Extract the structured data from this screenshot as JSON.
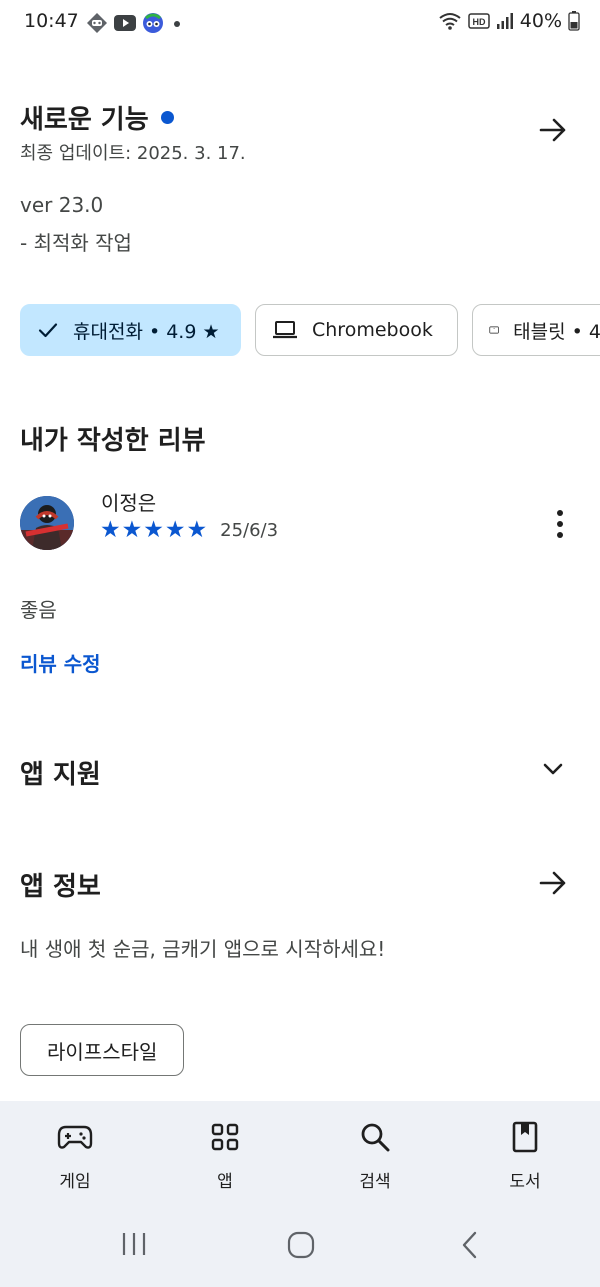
{
  "status_bar": {
    "time": "10:47",
    "battery_text": "40%",
    "icons_left": [
      "ai-badge-icon",
      "youtube-icon",
      "app-mascot-icon",
      "notification-dot-icon"
    ],
    "icons_right": [
      "wifi-icon",
      "hd-icon",
      "signal-icon",
      "battery-icon"
    ]
  },
  "whats_new": {
    "title": "새로운 기능",
    "last_updated": "최종 업데이트: 2025. 3. 17.",
    "version": "ver 23.0",
    "note": "- 최적화 작업",
    "accent_color": "#0b57d0"
  },
  "device_chips": [
    {
      "label": "휴대전화 • 4.9 ★",
      "icon": "check-icon",
      "selected": true
    },
    {
      "label": "Chromebook",
      "icon": "laptop-icon",
      "selected": false
    },
    {
      "label": "태블릿 • 4",
      "icon": "tablet-icon",
      "selected": false
    }
  ],
  "my_review": {
    "title": "내가 작성한 리뷰",
    "reviewer_name": "이정은",
    "rating": 5,
    "date": "25/6/3",
    "text": "좋음",
    "edit_label": "리뷰 수정"
  },
  "app_support": {
    "title": "앱 지원"
  },
  "app_info": {
    "title": "앱 정보",
    "description": "내 생애 첫 순금, 금캐기 앱으로 시작하세요!",
    "category": "라이프스타일"
  },
  "bottom_nav": [
    {
      "label": "게임",
      "icon": "gamepad-icon"
    },
    {
      "label": "앱",
      "icon": "apps-grid-icon"
    },
    {
      "label": "검색",
      "icon": "search-icon"
    },
    {
      "label": "도서",
      "icon": "book-icon"
    }
  ],
  "colors": {
    "accent": "#0b57d0",
    "chip_selected_bg": "#c2e7ff",
    "nav_bg": "#eef1f6"
  }
}
